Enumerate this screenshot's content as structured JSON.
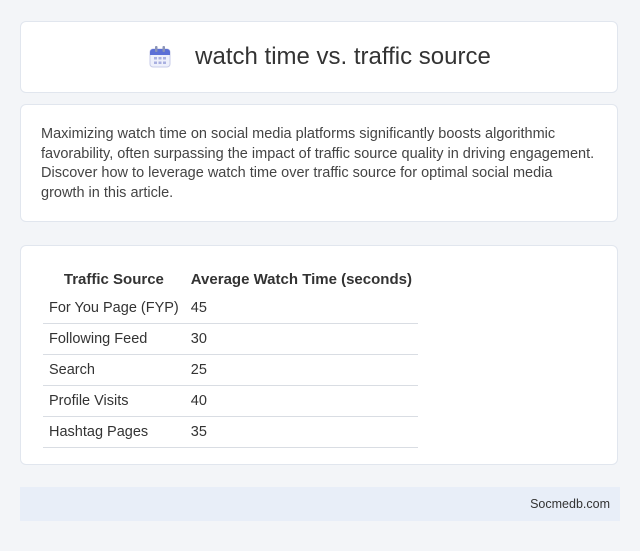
{
  "header": {
    "icon": "calendar-icon",
    "title": "watch time vs. traffic source"
  },
  "intro": {
    "text": "Maximizing watch time on social media platforms significantly boosts algorithmic favorability, often surpassing the impact of traffic source quality in driving engagement. Discover how to leverage watch time over traffic source for optimal social media growth in this article."
  },
  "table": {
    "headers": [
      "Traffic Source",
      "Average Watch Time (seconds)"
    ],
    "rows": [
      {
        "source": "For You Page (FYP)",
        "value": "45"
      },
      {
        "source": "Following Feed",
        "value": "30"
      },
      {
        "source": "Search",
        "value": "25"
      },
      {
        "source": "Profile Visits",
        "value": "40"
      },
      {
        "source": "Hashtag Pages",
        "value": "35"
      }
    ]
  },
  "footer": {
    "text": "Socmedb.com"
  }
}
